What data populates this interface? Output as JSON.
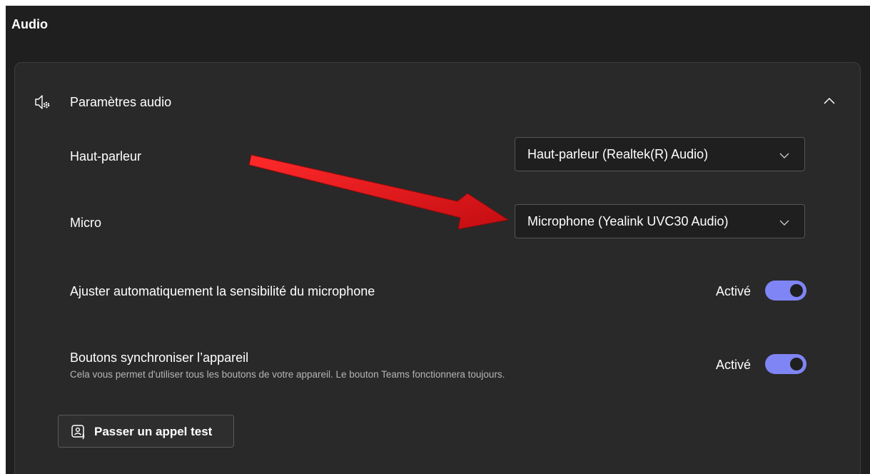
{
  "section": {
    "title": "Audio"
  },
  "audio_settings": {
    "header_title": "Paramètres audio",
    "header_icon": "speaker-gear-icon",
    "collapse_icon": "chevron-up-icon",
    "speaker": {
      "label": "Haut-parleur",
      "selected": "Haut-parleur (Realtek(R) Audio)"
    },
    "microphone": {
      "label": "Micro",
      "selected": "Microphone (Yealink UVC30 Audio)"
    },
    "auto_sensitivity": {
      "label": "Ajuster automatiquement la sensibilité du microphone",
      "state": "Activé",
      "on": true
    },
    "sync_buttons": {
      "label": "Boutons synchroniser l’appareil",
      "description": "Cela vous permet d'utiliser tous les boutons de votre appareil. Le bouton Teams fonctionnera toujours.",
      "state": "Activé",
      "on": true
    },
    "test_call": {
      "label": "Passer un appel test",
      "icon": "test-call-icon"
    }
  },
  "colors": {
    "background": "#1f1f1f",
    "card": "#292929",
    "accent": "#7f85f5",
    "annotation_arrow": "#e8141a"
  }
}
